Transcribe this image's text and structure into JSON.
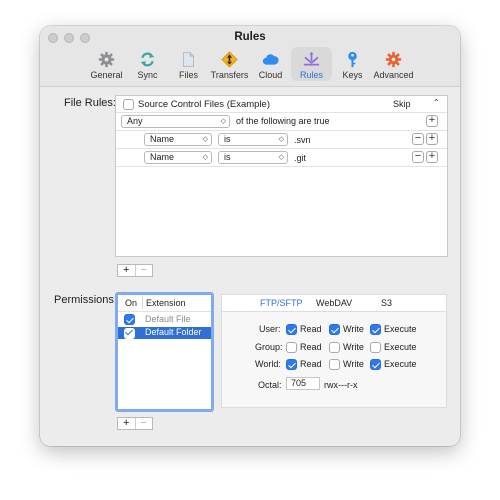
{
  "window": {
    "title": "Rules"
  },
  "toolbar": [
    {
      "label": "General",
      "icon": "gear-icon",
      "active": false
    },
    {
      "label": "Sync",
      "icon": "sync-icon",
      "active": false
    },
    {
      "label": "Files",
      "icon": "files-icon",
      "active": false
    },
    {
      "label": "Transfers",
      "icon": "transfers-icon",
      "active": false
    },
    {
      "label": "Cloud",
      "icon": "cloud-icon",
      "active": false
    },
    {
      "label": "Rules",
      "icon": "rules-icon",
      "active": true
    },
    {
      "label": "Keys",
      "icon": "keys-icon",
      "active": false
    },
    {
      "label": "Advanced",
      "icon": "advanced-icon",
      "active": false
    }
  ],
  "file_rules": {
    "section_label": "File Rules:",
    "rule_name": "Source Control Files (Example)",
    "rule_checked": false,
    "action": "Skip",
    "match_mode": "Any",
    "match_text": "of the following are true",
    "conditions": [
      {
        "field": "Name",
        "operator": "is",
        "value": ".svn"
      },
      {
        "field": "Name",
        "operator": "is",
        "value": ".git"
      }
    ]
  },
  "permissions": {
    "section_label": "Permissions:",
    "list_headers": {
      "on": "On",
      "extension": "Extension"
    },
    "items": [
      {
        "label": "Default File",
        "checked": true,
        "selected": false
      },
      {
        "label": "Default Folder",
        "checked": true,
        "selected": true
      }
    ],
    "tabs": [
      "FTP/SFTP",
      "WebDAV",
      "S3"
    ],
    "active_tab": "FTP/SFTP",
    "rows": [
      {
        "label": "User:",
        "read": true,
        "write": true,
        "execute": true
      },
      {
        "label": "Group:",
        "read": false,
        "write": false,
        "execute": false
      },
      {
        "label": "World:",
        "read": true,
        "write": false,
        "execute": true
      }
    ],
    "cols": {
      "read": "Read",
      "write": "Write",
      "execute": "Execute"
    },
    "octal_label": "Octal:",
    "octal_value": "705",
    "mode_string": "rwx---r-x"
  },
  "buttons": {
    "plus": "+",
    "minus": "−"
  },
  "colors": {
    "accent": "#2f79ee",
    "selection": "#2f6fd6"
  }
}
